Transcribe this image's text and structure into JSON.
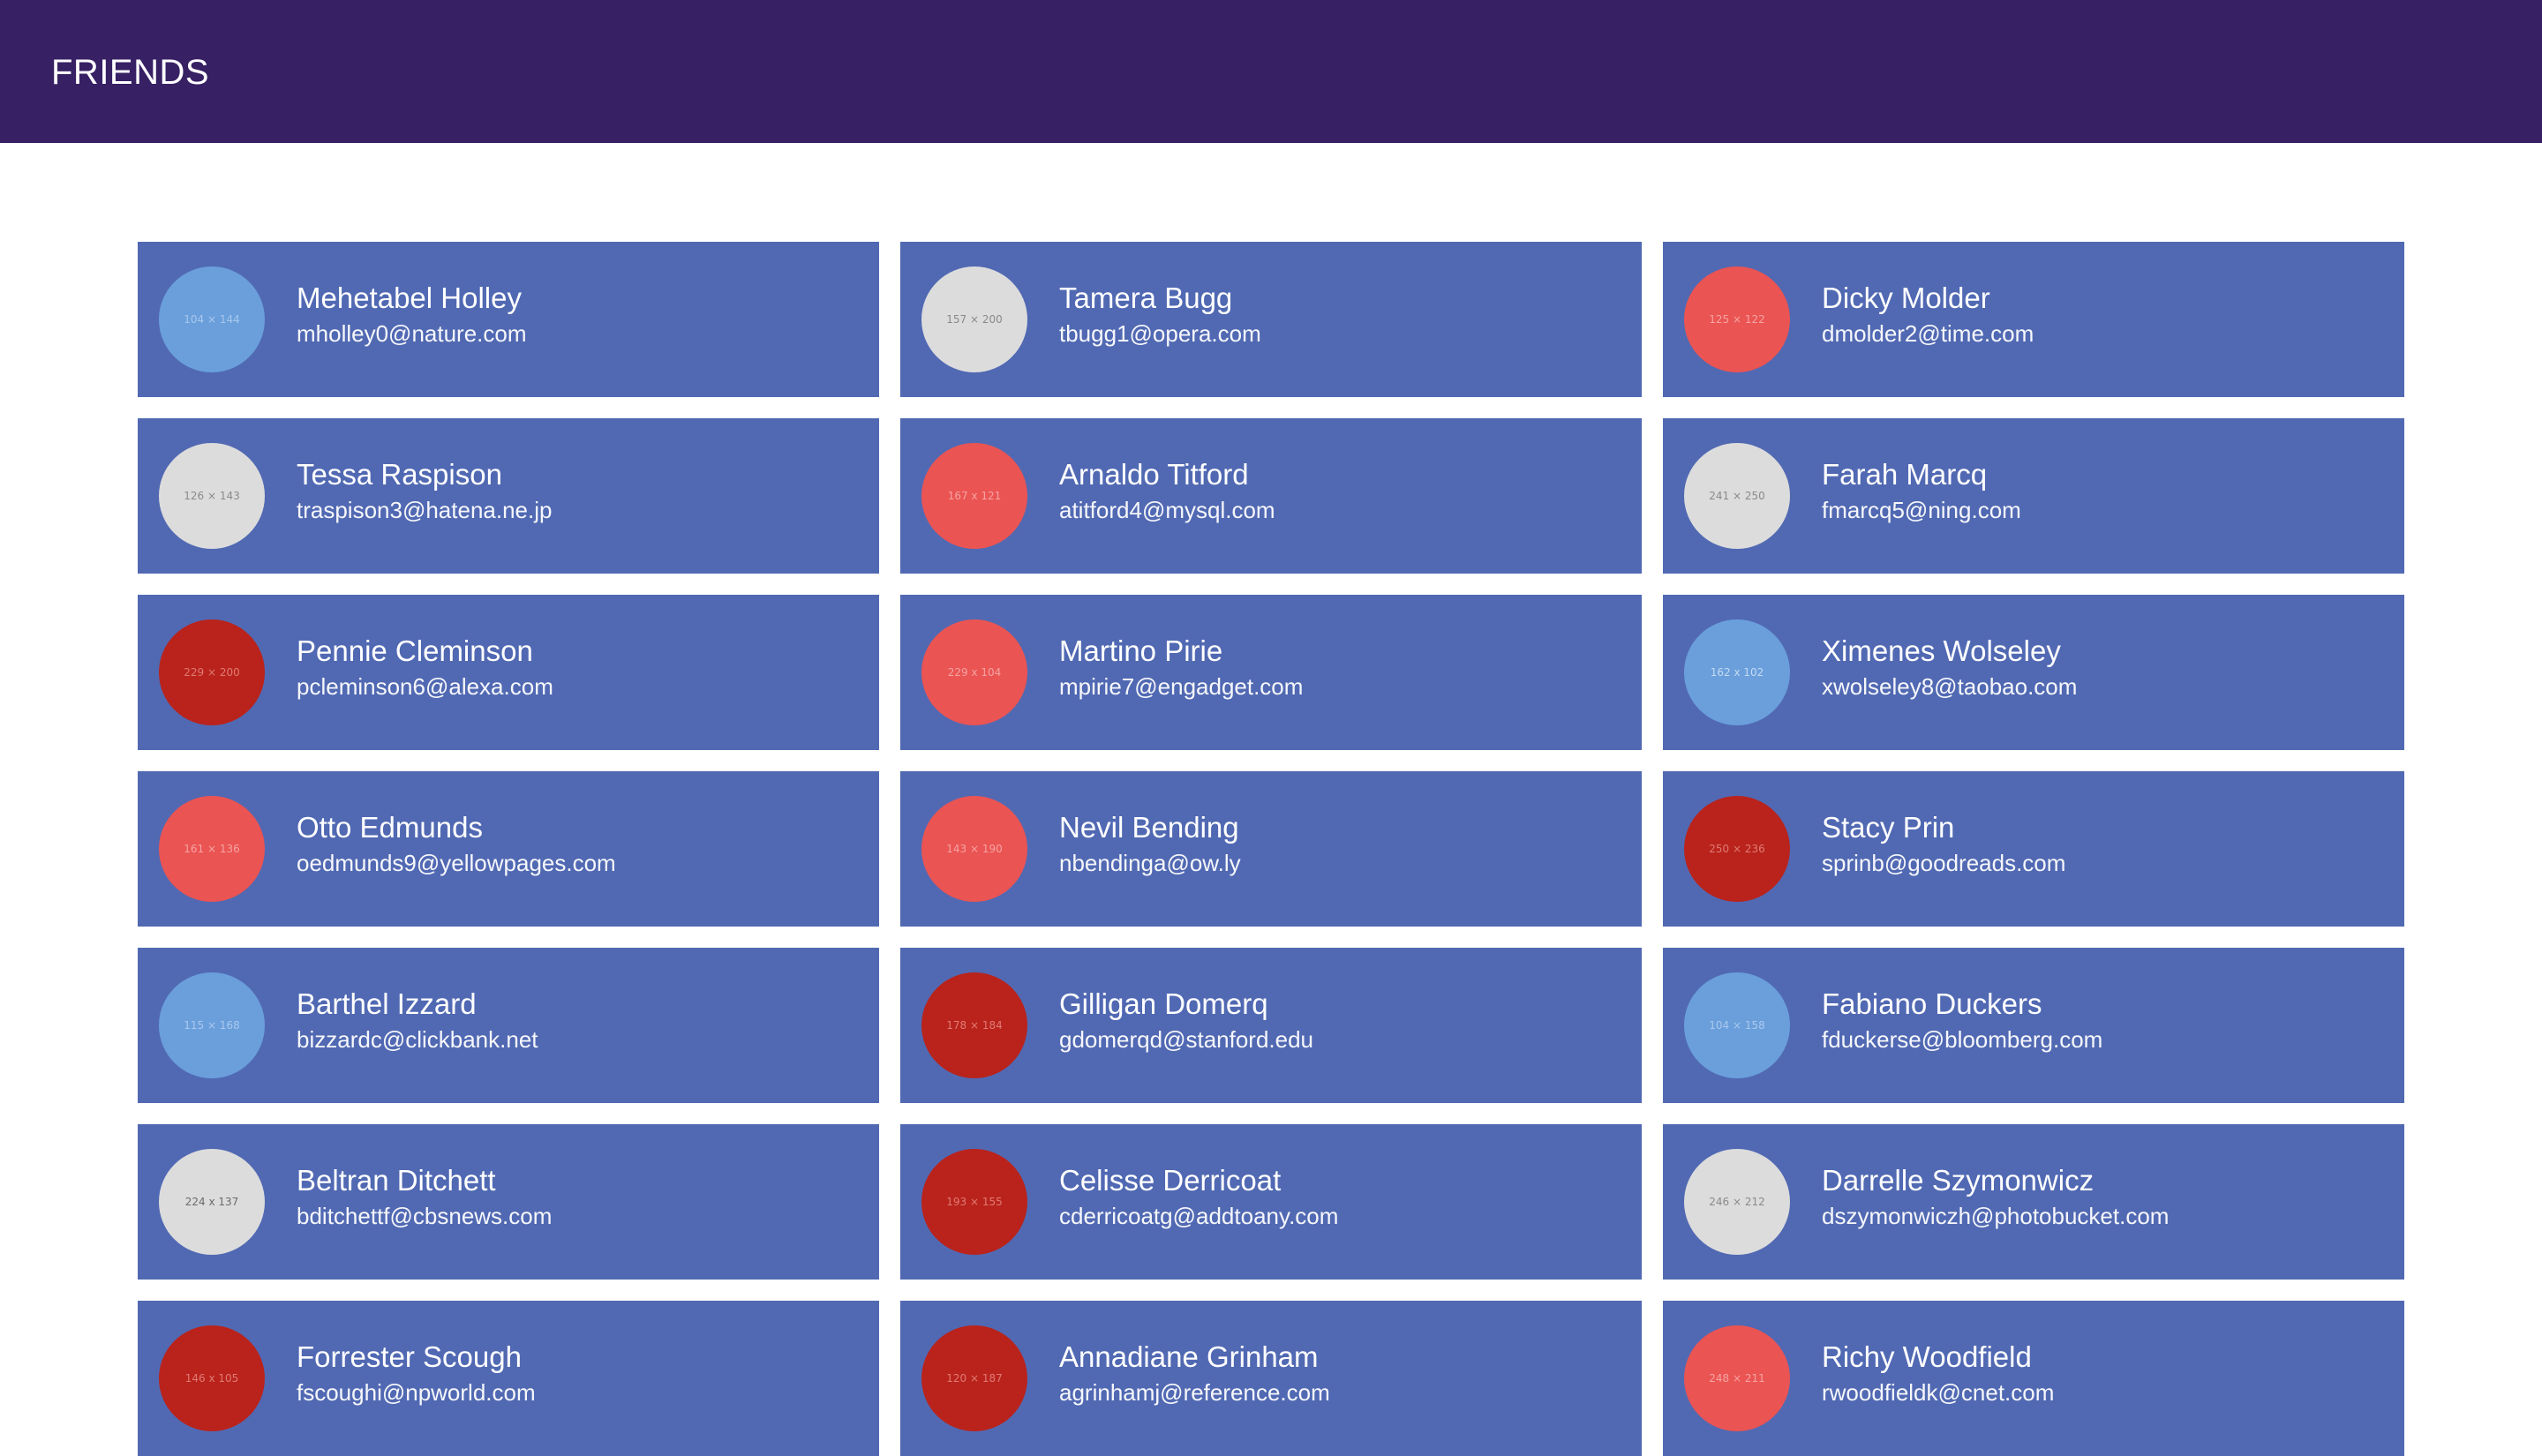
{
  "header": {
    "title": "FRIENDS",
    "background": "#372064"
  },
  "colors": {
    "card": "#5169b3",
    "avatar_blue": "#6a9fdb",
    "avatar_gray": "#dcdcdc",
    "avatar_red": "#ea5453",
    "avatar_darkred": "#b9231c"
  },
  "friends": [
    {
      "name": "Mehetabel Holley",
      "email": "mholley0@nature.com",
      "avatar": {
        "label": "104 × 144",
        "color": "#6a9fdb",
        "text_color": "#a9c8ee"
      }
    },
    {
      "name": "Tamera Bugg",
      "email": "tbugg1@opera.com",
      "avatar": {
        "label": "157 × 200",
        "color": "#dcdcdc",
        "text_color": "#8a8a8a"
      }
    },
    {
      "name": "Dicky Molder",
      "email": "dmolder2@time.com",
      "avatar": {
        "label": "125 × 122",
        "color": "#ea5453",
        "text_color": "#f5a3a2"
      }
    },
    {
      "name": "Tessa Raspison",
      "email": "traspison3@hatena.ne.jp",
      "avatar": {
        "label": "126 × 143",
        "color": "#dcdcdc",
        "text_color": "#8a8a8a"
      }
    },
    {
      "name": "Arnaldo Titford",
      "email": "atitford4@mysql.com",
      "avatar": {
        "label": "167 x 121",
        "color": "#ea5453",
        "text_color": "#f5a3a2"
      }
    },
    {
      "name": "Farah Marcq",
      "email": "fmarcq5@ning.com",
      "avatar": {
        "label": "241 × 250",
        "color": "#dcdcdc",
        "text_color": "#8a8a8a"
      }
    },
    {
      "name": "Pennie Cleminson",
      "email": "pcleminson6@alexa.com",
      "avatar": {
        "label": "229 × 200",
        "color": "#b9231c",
        "text_color": "#e07a74"
      }
    },
    {
      "name": "Martino Pirie",
      "email": "mpirie7@engadget.com",
      "avatar": {
        "label": "229 x 104",
        "color": "#ea5453",
        "text_color": "#f5a3a2"
      }
    },
    {
      "name": "Ximenes Wolseley",
      "email": "xwolseley8@taobao.com",
      "avatar": {
        "label": "162 x 102",
        "color": "#6a9fdb",
        "text_color": "#c4daf3"
      }
    },
    {
      "name": "Otto Edmunds",
      "email": "oedmunds9@yellowpages.com",
      "avatar": {
        "label": "161 × 136",
        "color": "#ea5453",
        "text_color": "#f5a3a2"
      }
    },
    {
      "name": "Nevil Bending",
      "email": "nbendinga@ow.ly",
      "avatar": {
        "label": "143 × 190",
        "color": "#ea5453",
        "text_color": "#f5a3a2"
      }
    },
    {
      "name": "Stacy Prin",
      "email": "sprinb@goodreads.com",
      "avatar": {
        "label": "250 × 236",
        "color": "#b9231c",
        "text_color": "#e07a74"
      }
    },
    {
      "name": "Barthel Izzard",
      "email": "bizzardc@clickbank.net",
      "avatar": {
        "label": "115 × 168",
        "color": "#6a9fdb",
        "text_color": "#a9c8ee"
      }
    },
    {
      "name": "Gilligan Domerq",
      "email": "gdomerqd@stanford.edu",
      "avatar": {
        "label": "178 × 184",
        "color": "#b9231c",
        "text_color": "#e07a74"
      }
    },
    {
      "name": "Fabiano Duckers",
      "email": "fduckerse@bloomberg.com",
      "avatar": {
        "label": "104 × 158",
        "color": "#6a9fdb",
        "text_color": "#a9c8ee"
      }
    },
    {
      "name": "Beltran Ditchett",
      "email": "bditchettf@cbsnews.com",
      "avatar": {
        "label": "224 x 137",
        "color": "#dcdcdc",
        "text_color": "#6a6a6a"
      }
    },
    {
      "name": "Celisse Derricoat",
      "email": "cderricoatg@addtoany.com",
      "avatar": {
        "label": "193 × 155",
        "color": "#b9231c",
        "text_color": "#e07a74"
      }
    },
    {
      "name": "Darrelle Szymonwicz",
      "email": "dszymonwiczh@photobucket.com",
      "avatar": {
        "label": "246 × 212",
        "color": "#dcdcdc",
        "text_color": "#8a8a8a"
      }
    },
    {
      "name": "Forrester Scough",
      "email": "fscoughi@npworld.com",
      "avatar": {
        "label": "146 x 105",
        "color": "#b9231c",
        "text_color": "#e07a74"
      }
    },
    {
      "name": "Annadiane Grinham",
      "email": "agrinhamj@reference.com",
      "avatar": {
        "label": "120 × 187",
        "color": "#b9231c",
        "text_color": "#e07a74"
      }
    },
    {
      "name": "Richy Woodfield",
      "email": "rwoodfieldk@cnet.com",
      "avatar": {
        "label": "248 × 211",
        "color": "#ea5453",
        "text_color": "#f5a3a2"
      }
    }
  ]
}
